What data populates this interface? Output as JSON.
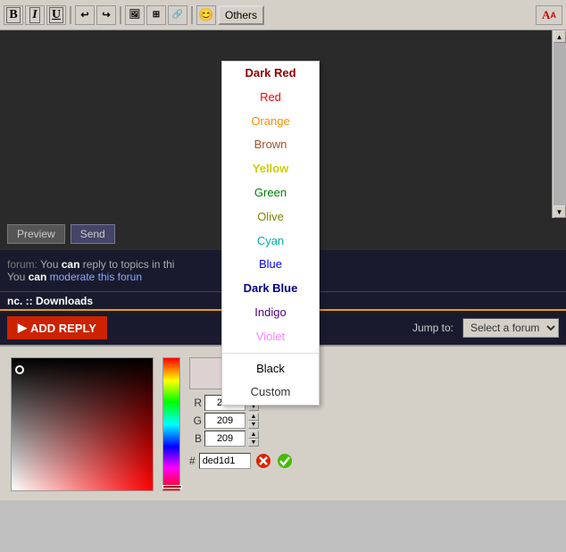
{
  "toolbar": {
    "bold": "B",
    "italic": "I",
    "underline": "U",
    "others_label": "Others",
    "font_label": "A"
  },
  "color_dropdown": {
    "items": [
      {
        "label": "Dark Red",
        "color": "#8b0000"
      },
      {
        "label": "Red",
        "color": "#ff0000"
      },
      {
        "label": "Orange",
        "color": "#ff8c00"
      },
      {
        "label": "Brown",
        "color": "#a0522d"
      },
      {
        "label": "Yellow",
        "color": "#ffff00"
      },
      {
        "label": "Green",
        "color": "#008000"
      },
      {
        "label": "Olive",
        "color": "#808000"
      },
      {
        "label": "Cyan",
        "color": "#00ffff"
      },
      {
        "label": "Blue",
        "color": "#0000ff"
      },
      {
        "label": "Dark Blue",
        "color": "#00008b"
      },
      {
        "label": "Indigo",
        "color": "#4b0082"
      },
      {
        "label": "Violet",
        "color": "#ff80ff"
      },
      {
        "label": "Black",
        "color": "#000000"
      },
      {
        "label": "Custom",
        "color": "#333333"
      }
    ]
  },
  "bottom_bar": {
    "preview_label": "Preview",
    "send_label": "Send"
  },
  "forum_bar": {
    "prefix": "forum:",
    "text1": "You ",
    "can": "can",
    "text2": " reply to topics in thi",
    "text3": "You ",
    "can2": "can",
    "text4": " moderate this forun"
  },
  "nav_bar": {
    "text": "nc. :: Downloads"
  },
  "reply_bar": {
    "add_reply_label": "ADD REPLY",
    "jump_to": "Jump to:",
    "forum_select_placeholder": "Select a forum"
  },
  "color_picker": {
    "r_label": "R",
    "g_label": "G",
    "b_label": "B",
    "r_value": "222",
    "g_value": "209",
    "b_value": "209",
    "hash_label": "#",
    "hex_value": "ded1d1"
  }
}
